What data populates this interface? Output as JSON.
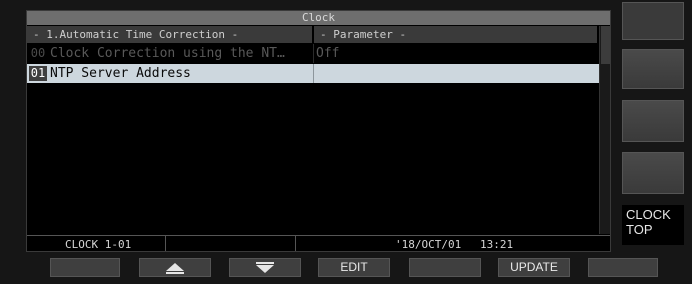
{
  "window": {
    "title": "Clock"
  },
  "table": {
    "header_item": "- 1.Automatic Time Correction -",
    "header_param": "- Parameter -",
    "rows": [
      {
        "num": "00",
        "item": "Clock Correction using the NT…",
        "param": "Off",
        "state": "disabled"
      },
      {
        "num": "01",
        "item": "NTP Server Address",
        "param": "",
        "state": "selected"
      }
    ]
  },
  "status": {
    "page": "CLOCK 1-01",
    "date": "'18/OCT/01",
    "time": "13:21"
  },
  "side_keys": [
    {
      "label": ""
    },
    {
      "label": ""
    },
    {
      "label": ""
    },
    {
      "label": ""
    },
    {
      "label_line1": "CLOCK",
      "label_line2": "TOP"
    }
  ],
  "bottom_keys": [
    {
      "label": ""
    },
    {
      "icon": "up-arrow-icon"
    },
    {
      "icon": "down-arrow-icon"
    },
    {
      "label": "EDIT"
    },
    {
      "label": ""
    },
    {
      "label": "UPDATE"
    },
    {
      "label": ""
    }
  ],
  "colors": {
    "title_bar": "#6e6e6e",
    "header_bg": "#3a3a3a",
    "selected_row": "#cdd7de",
    "disabled_text": "#595959"
  }
}
